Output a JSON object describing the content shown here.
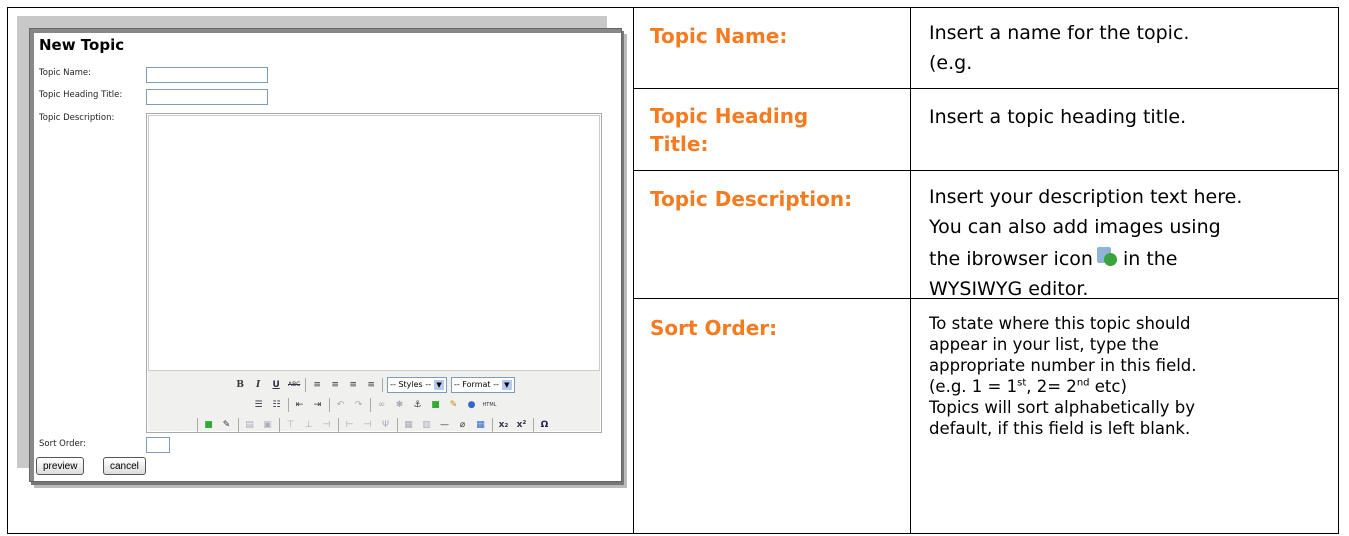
{
  "screenshot": {
    "title": "New Topic",
    "fields": {
      "topic_name": "Topic Name:",
      "topic_heading_title": "Topic Heading Title:",
      "topic_description": "Topic Description:",
      "sort_order": "Sort Order:"
    },
    "toolbar": {
      "styles_select": "-- Styles --",
      "format_select": "-- Format --",
      "html_label": "HTML"
    },
    "buttons": {
      "preview": "preview",
      "cancel": "cancel"
    }
  },
  "table": {
    "rows": [
      {
        "label": "Topic Name:",
        "desc": "Insert a name for the topic.",
        "desc2": "(e.g."
      },
      {
        "label_line1": "Topic Heading",
        "label_line2": "Title:",
        "desc": "Insert a topic heading title."
      },
      {
        "label": "Topic Description:",
        "desc_line1": "Insert your description text here.",
        "desc_line2": "You can also add images using",
        "desc_line3a": "the ibrowser icon",
        "desc_line3b": "in the",
        "desc_line4": "WYSIWYG editor."
      },
      {
        "label": "Sort Order:",
        "l1": "To state where this topic should",
        "l2": "appear in your list, type the",
        "l3": "appropriate number in this field.",
        "l4_a": "(e.g. 1 = 1",
        "l4_sup1": "st",
        "l4_b": ", 2= 2",
        "l4_sup2": "nd",
        "l4_c": " etc)",
        "l5": "Topics will sort alphabetically by",
        "l6": "default, if this field is left blank."
      }
    ]
  }
}
